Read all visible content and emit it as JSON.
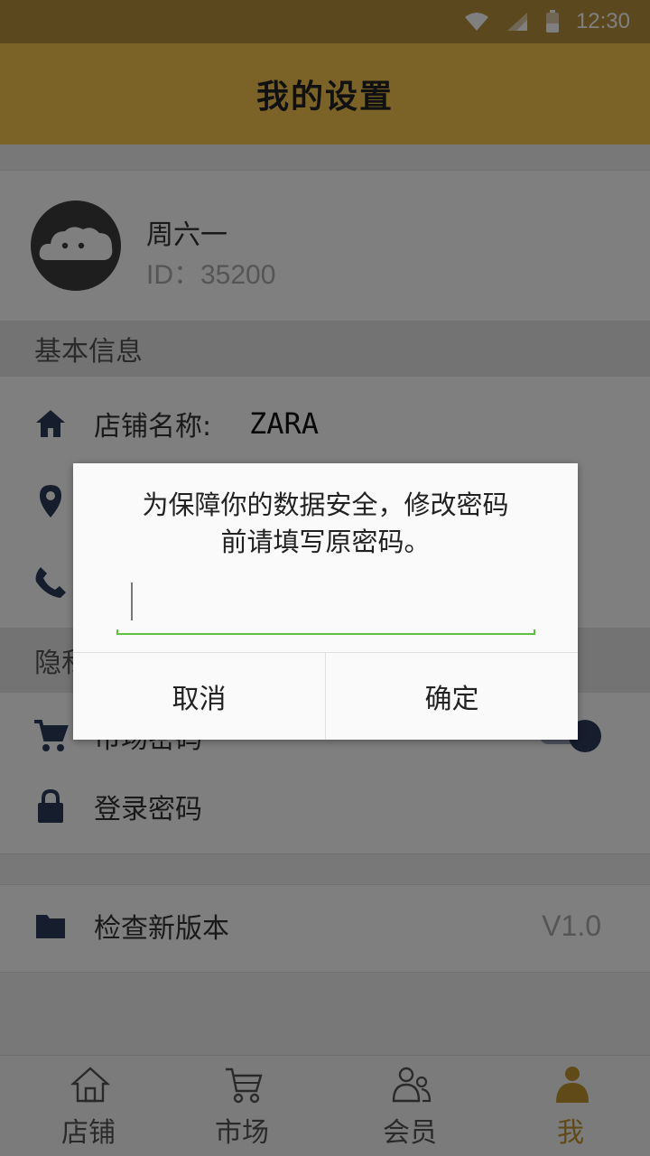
{
  "status_bar": {
    "time": "12:30"
  },
  "header": {
    "title": "我的设置"
  },
  "profile": {
    "name": "周六一",
    "id_text": "ID：35200"
  },
  "basic_info": {
    "heading": "基本信息",
    "store_name_label": "店铺名称:",
    "store_name_value": "ZARA"
  },
  "privacy": {
    "heading": "隐私",
    "market_password_label": "市场密码",
    "market_password_enabled": true,
    "login_password_label": "登录密码"
  },
  "update": {
    "label": "检查新版本",
    "version": "V1.0"
  },
  "bottom_nav": {
    "active": "我",
    "tabs": [
      {
        "label": "店铺",
        "icon": "store-icon"
      },
      {
        "label": "市场",
        "icon": "cart-icon"
      },
      {
        "label": "会员",
        "icon": "members-icon"
      },
      {
        "label": "我",
        "icon": "person-icon"
      }
    ]
  },
  "dialog": {
    "message_line1": "为保障你的数据安全，修改密码",
    "message_line2": "前请填写原密码。",
    "input_value": "",
    "cancel_label": "取消",
    "confirm_label": "确定"
  },
  "colors": {
    "status_bar": "#b8913c",
    "title_bar": "#f7c64e",
    "accent": "#c0952e",
    "icon": "#2d3a5a",
    "input_underline": "#5fbf3a"
  }
}
